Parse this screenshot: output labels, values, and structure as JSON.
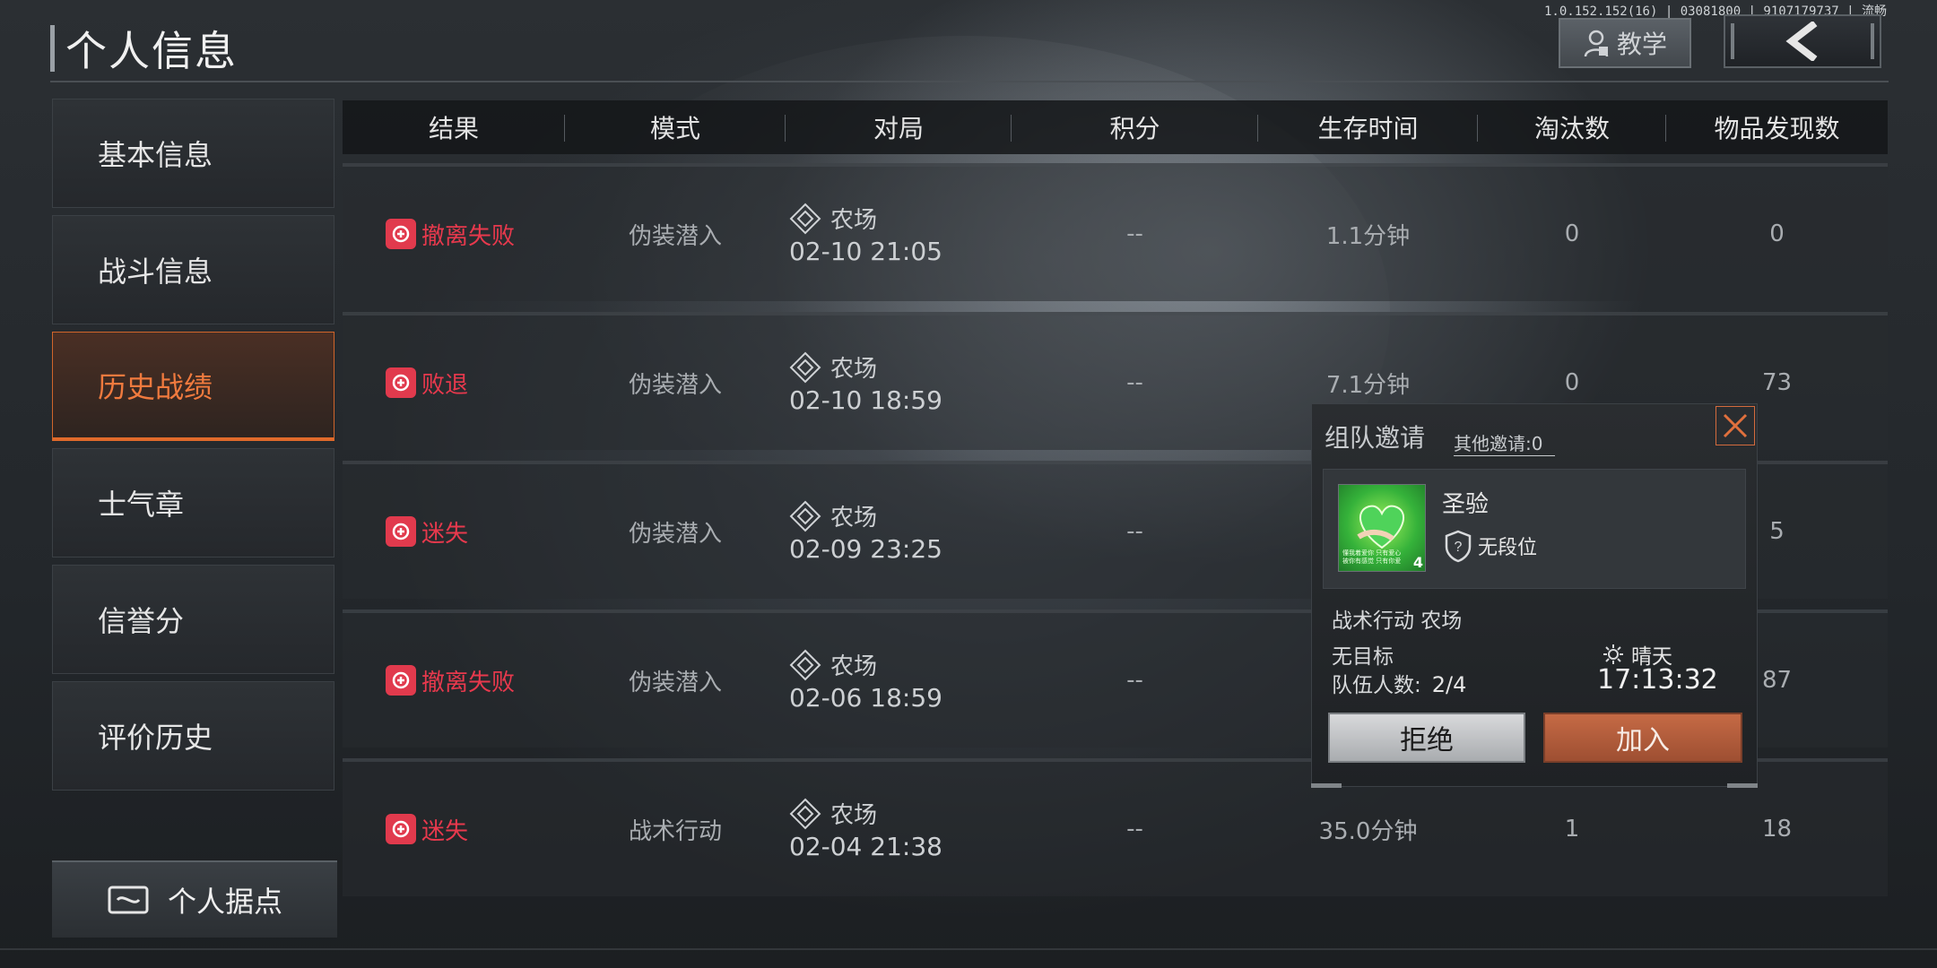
{
  "version_text": "1.0.152.152(16) | 03081800 | 9107179737 | 流畅",
  "page_title": "个人信息",
  "header_buttons": {
    "teach_label": "教学"
  },
  "sidebar": {
    "items": [
      {
        "label": "基本信息",
        "active": false
      },
      {
        "label": "战斗信息",
        "active": false
      },
      {
        "label": "历史战绩",
        "active": true
      },
      {
        "label": "士气章",
        "active": false
      },
      {
        "label": "信誉分",
        "active": false
      },
      {
        "label": "评价历史",
        "active": false
      }
    ],
    "base_button": "个人据点"
  },
  "table": {
    "headers": [
      "结果",
      "模式",
      "对局",
      "积分",
      "生存时间",
      "淘汰数",
      "物品发现数"
    ],
    "rows": [
      {
        "result": "撤离失败",
        "mode": "伪装潜入",
        "map": "农场",
        "date": "02-10 21:05",
        "score": "--",
        "time": "1.1分钟",
        "kills": "0",
        "items": "0"
      },
      {
        "result": "败退",
        "mode": "伪装潜入",
        "map": "农场",
        "date": "02-10 18:59",
        "score": "--",
        "time": "7.1分钟",
        "kills": "0",
        "items": "73"
      },
      {
        "result": "迷失",
        "mode": "伪装潜入",
        "map": "农场",
        "date": "02-09 23:25",
        "score": "--",
        "time": "",
        "kills": "",
        "items": "5"
      },
      {
        "result": "撤离失败",
        "mode": "伪装潜入",
        "map": "农场",
        "date": "02-06 18:59",
        "score": "--",
        "time": "",
        "kills": "",
        "items": "87"
      },
      {
        "result": "迷失",
        "mode": "战术行动",
        "map": "农场",
        "date": "02-04 21:38",
        "score": "--",
        "time": "35.0分钟",
        "kills": "1",
        "items": "18"
      }
    ]
  },
  "popup": {
    "title": "组队邀请",
    "other_invites": "其他邀请:0",
    "user_name": "圣验",
    "avatar_level": "4",
    "avatar_caption_1": "懂我着爱你 只有爱心",
    "avatar_caption_2": "被你有感觉 只有你爱",
    "rank": "无段位",
    "operation": "战术行动 农场",
    "target": "无目标",
    "team_label": "队伍人数:",
    "team_count": "2/4",
    "weather": "晴天",
    "clock": "17:13:32",
    "refuse_label": "拒绝",
    "join_label": "加入"
  },
  "colors": {
    "accent": "#e06a2b",
    "result_red": "#e8394d",
    "join": "#b15e3d"
  }
}
